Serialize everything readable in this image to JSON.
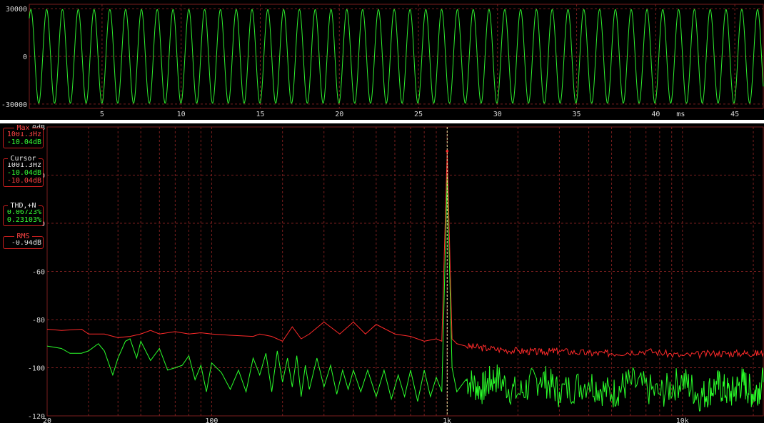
{
  "colors": {
    "background": "#000000",
    "grid": "#7a1e1e",
    "waveform": "#2ef02e",
    "spectrum_max": "#ff2a2a",
    "spectrum_live": "#2aff2a",
    "cursor": "#f0e2a0"
  },
  "chart_data": [
    {
      "type": "line",
      "title": "",
      "xlabel": "ms",
      "ylabel": "",
      "xlim": [
        0.4,
        46.8
      ],
      "ylim": [
        -32768,
        32768
      ],
      "x_ticks": [
        5,
        10,
        15,
        20,
        25,
        30,
        35,
        40,
        45
      ],
      "x_tick_labels": [
        "5",
        "10",
        "15",
        "20",
        "25",
        "30",
        "35",
        "40",
        "45"
      ],
      "y_ticks": [
        30000,
        0,
        -30000
      ],
      "y_tick_labels": [
        "30000",
        "0",
        "-30000"
      ],
      "grid": true,
      "series": [
        {
          "frequency_hz": 1001.3,
          "amplitude": 29500
        }
      ]
    },
    {
      "type": "line",
      "title": "",
      "xlabel": "",
      "ylabel": "",
      "x_scale": "log",
      "xlim": [
        20,
        22050
      ],
      "ylim": [
        -120,
        0
      ],
      "x_ticks": [
        20,
        100,
        1000,
        10000
      ],
      "x_tick_labels": [
        "20",
        "100",
        "1k",
        "10k"
      ],
      "y_ticks": [
        0,
        -20,
        -40,
        -60,
        -80,
        -100,
        -120
      ],
      "y_tick_labels": [
        "0dB",
        "-20",
        "-40",
        "-60",
        "-80",
        "-100",
        "-120"
      ],
      "grid": true,
      "cursor_x": 1001.3,
      "peak": {
        "x": 1001.3,
        "y": -10.04
      },
      "series": [
        {
          "color_role": "max",
          "x": [
            20,
            23,
            28,
            30,
            35,
            40,
            45,
            50,
            55,
            60,
            70,
            80,
            90,
            100,
            120,
            150,
            160,
            180,
            200,
            220,
            240,
            260,
            300,
            350,
            400,
            450,
            500,
            600,
            700,
            800,
            900,
            950,
            1001.3,
            1050,
            1100,
            1200,
            1500,
            2000,
            2500,
            3000,
            4000,
            5000,
            7000,
            10000,
            14000,
            18000,
            22050
          ],
          "y": [
            -84,
            -84.5,
            -84,
            -86,
            -86,
            -87.5,
            -87,
            -86,
            -84.5,
            -86,
            -85,
            -86,
            -85.5,
            -86,
            -86.5,
            -87,
            -86,
            -87,
            -89,
            -83,
            -88,
            -86,
            -81,
            -86,
            -81,
            -86,
            -82,
            -86,
            -87,
            -89,
            -88,
            -89,
            -10.04,
            -88,
            -90,
            -91,
            -92,
            -93,
            -93.5,
            -93,
            -94,
            -94,
            -93,
            -95,
            -94,
            -94,
            -94
          ]
        },
        {
          "color_role": "live",
          "x": [
            20,
            23,
            25,
            28,
            30,
            33,
            35,
            38,
            40,
            43,
            45,
            48,
            50,
            55,
            60,
            65,
            70,
            75,
            80,
            85,
            90,
            95,
            100,
            110,
            120,
            130,
            140,
            150,
            160,
            170,
            180,
            190,
            200,
            210,
            220,
            230,
            240,
            250,
            260,
            280,
            300,
            320,
            340,
            360,
            380,
            400,
            430,
            460,
            500,
            540,
            580,
            620,
            660,
            700,
            750,
            800,
            850,
            900,
            950,
            1001.3,
            1050,
            1100,
            1200,
            1400,
            1600,
            2000,
            2500,
            3000,
            4000,
            5000,
            6000,
            8000,
            10000,
            12000,
            14000,
            16000,
            18000,
            20000,
            22050
          ],
          "y": [
            -91,
            -92,
            -94,
            -94,
            -93,
            -90,
            -93,
            -103,
            -96,
            -89,
            -88,
            -96,
            -89,
            -97,
            -92,
            -101,
            -100,
            -99,
            -95,
            -105,
            -99,
            -110,
            -98,
            -102,
            -109,
            -101,
            -110,
            -96,
            -103,
            -94,
            -110,
            -93,
            -106,
            -96,
            -108,
            -95,
            -112,
            -99,
            -109,
            -96,
            -108,
            -99,
            -111,
            -101,
            -109,
            -101,
            -110,
            -101,
            -112,
            -101,
            -113,
            -103,
            -112,
            -101,
            -114,
            -101,
            -112,
            -104,
            -110,
            -20,
            -100,
            -110,
            -105,
            -109,
            -104,
            -111,
            -104,
            -110,
            -106,
            -111,
            -106,
            -111,
            -105,
            -112,
            -107,
            -111,
            -106,
            -111,
            -106
          ]
        }
      ]
    }
  ],
  "readouts": {
    "max": {
      "title": "Max",
      "frequency": "1001.3Hz",
      "level": "-10.04dB"
    },
    "cursor": {
      "title": "Cursor",
      "frequency": "1001.3Hz",
      "level_live": "-10.04dB",
      "level_max": "-10.04dB"
    },
    "thd": {
      "title": "THD,+N",
      "thd": "0.06723%",
      "thdn": "0.23103%"
    },
    "rms": {
      "title": "RMS",
      "level": "-0.94dB"
    }
  }
}
